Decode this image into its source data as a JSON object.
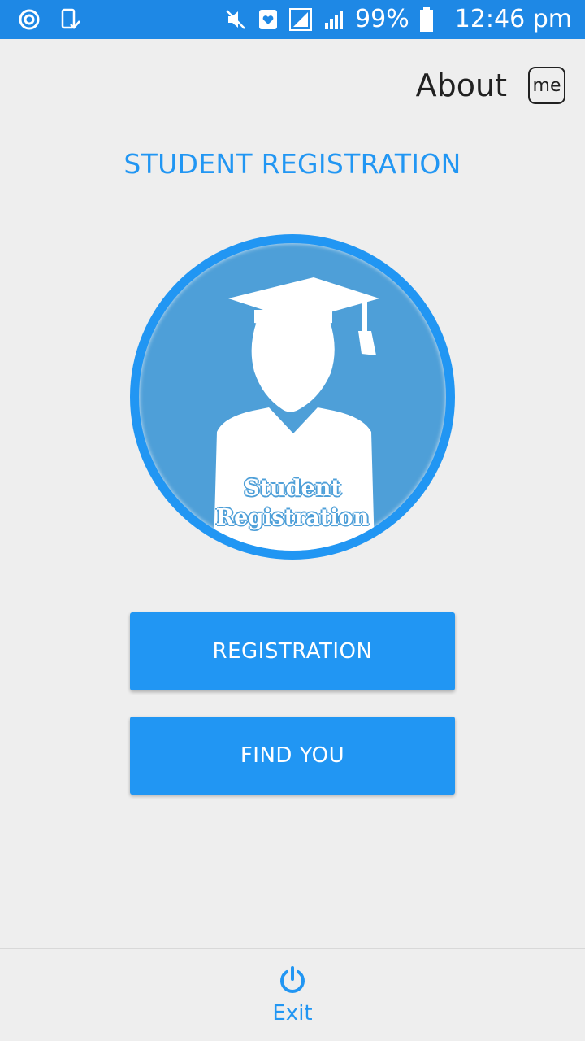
{
  "status_bar": {
    "battery": "99%",
    "time": "12:46 pm",
    "icons": [
      "sync-icon",
      "phone-check-icon",
      "mute-icon",
      "heart-notification-icon",
      "signal-icon",
      "signal-icon",
      "battery-icon"
    ]
  },
  "header": {
    "about_label": "About",
    "me_icon_text": "me"
  },
  "title": "STUDENT REGISTRATION",
  "logo": {
    "line1": "Student",
    "line2": "Registration"
  },
  "buttons": {
    "registration": "REGISTRATION",
    "find_you": "FIND YOU"
  },
  "footer": {
    "exit_label": "Exit",
    "icon": "power-icon"
  },
  "colors": {
    "accent": "#2196f3",
    "status_bar": "#1e88e5",
    "background": "#eeeeee"
  }
}
